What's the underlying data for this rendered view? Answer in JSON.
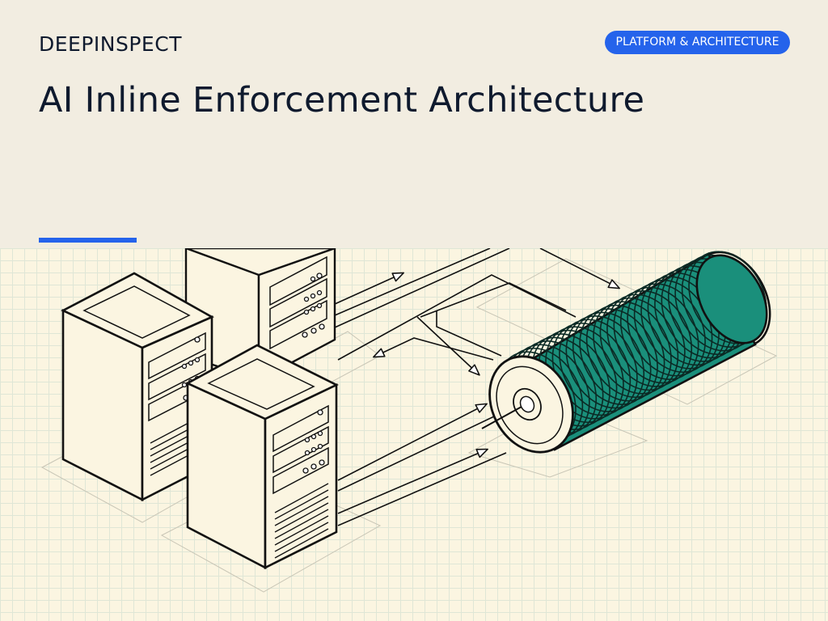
{
  "header": {
    "brand": "DEEPINSPECT",
    "category_badge": "PLATFORM & ARCHITECTURE",
    "title": "AI Inline Enforcement Architecture"
  },
  "illustration": {
    "server_count": 3,
    "server_icon": "server-tower-icon",
    "enforcement_icon": "cylinder-inspection-unit-icon",
    "colors": {
      "accent": "#2563eb",
      "cylinder_band": "#1a8f7b",
      "grid_line": "#dfe6d6",
      "panel_bg": "#fbf5e1",
      "header_bg": "#f2ede1",
      "ink": "#0f1a2e"
    }
  }
}
